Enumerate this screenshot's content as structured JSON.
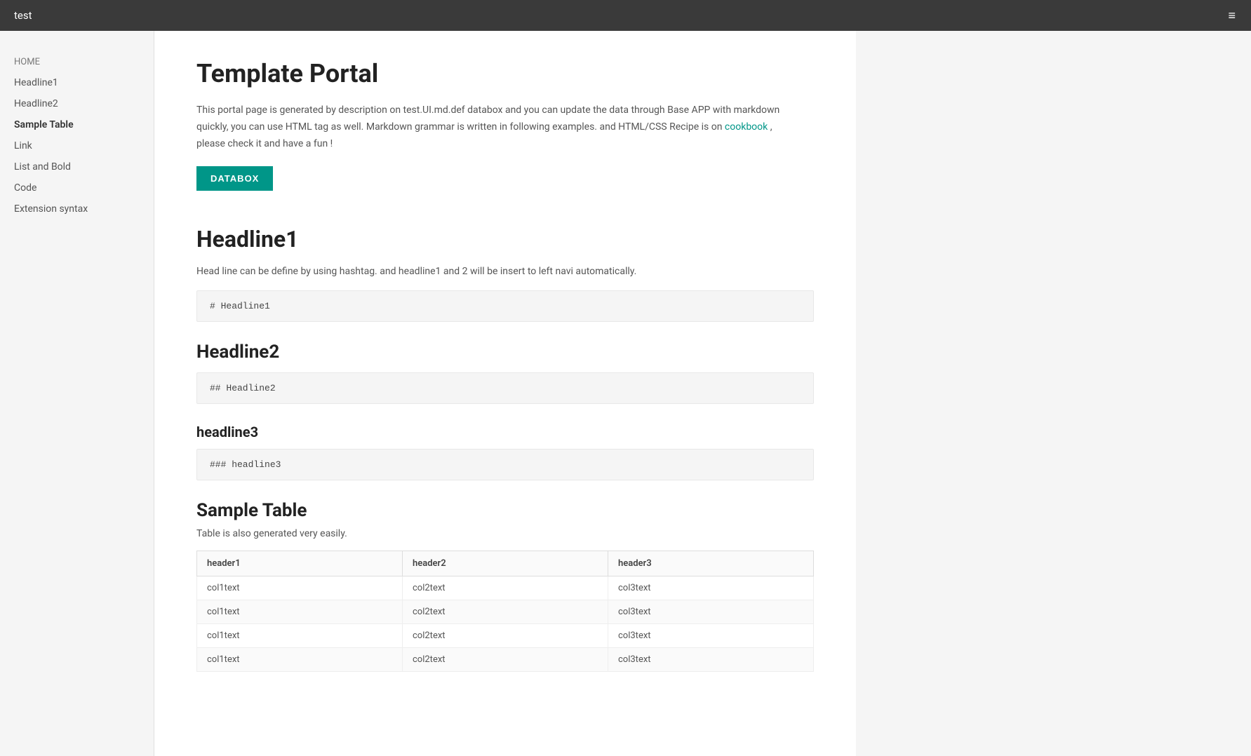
{
  "navbar": {
    "title": "test",
    "menu_icon": "≡"
  },
  "sidebar": {
    "items": [
      {
        "id": "home",
        "label": "HOME",
        "class": "home"
      },
      {
        "id": "headline1",
        "label": "Headline1",
        "class": ""
      },
      {
        "id": "headline2",
        "label": "Headline2",
        "class": ""
      },
      {
        "id": "sample-table",
        "label": "Sample Table",
        "class": "active"
      },
      {
        "id": "link",
        "label": "Link",
        "class": ""
      },
      {
        "id": "list-and-bold",
        "label": "List and Bold",
        "class": ""
      },
      {
        "id": "code",
        "label": "Code",
        "class": ""
      },
      {
        "id": "extension-syntax",
        "label": "Extension syntax",
        "class": ""
      }
    ]
  },
  "main": {
    "page_title": "Template Portal",
    "description_1": "This portal page is generated by description on test.UI.md.def databox and you can update the data through Base APP with markdown quickly, you can use HTML tag as well. Markdown grammar is written in following examples. and HTML/CSS Recipe is on ",
    "description_link_text": "cookbook",
    "description_2": " , please check it and have a fun !",
    "btn_databox": "DATABOX",
    "sections": [
      {
        "id": "headline1",
        "heading": "Headline1",
        "level": "h1",
        "desc": "Head line can be define by using hashtag. and headline1 and 2 will be insert to left navi automatically.",
        "code": "# Headline1"
      },
      {
        "id": "headline2",
        "heading": "Headline2",
        "level": "h2",
        "desc": "",
        "code": "## Headline2"
      },
      {
        "id": "headline3",
        "heading": "headline3",
        "level": "h3",
        "desc": "",
        "code": "### headline3"
      }
    ],
    "table_section": {
      "title": "Sample Table",
      "desc": "Table is also generated very easily.",
      "headers": [
        "header1",
        "header2",
        "header3"
      ],
      "rows": [
        [
          "col1text",
          "col2text",
          "col3text"
        ],
        [
          "col1text",
          "col2text",
          "col3text"
        ],
        [
          "col1text",
          "col2text",
          "col3text"
        ],
        [
          "col1text",
          "col2text",
          "col3text"
        ]
      ]
    }
  }
}
